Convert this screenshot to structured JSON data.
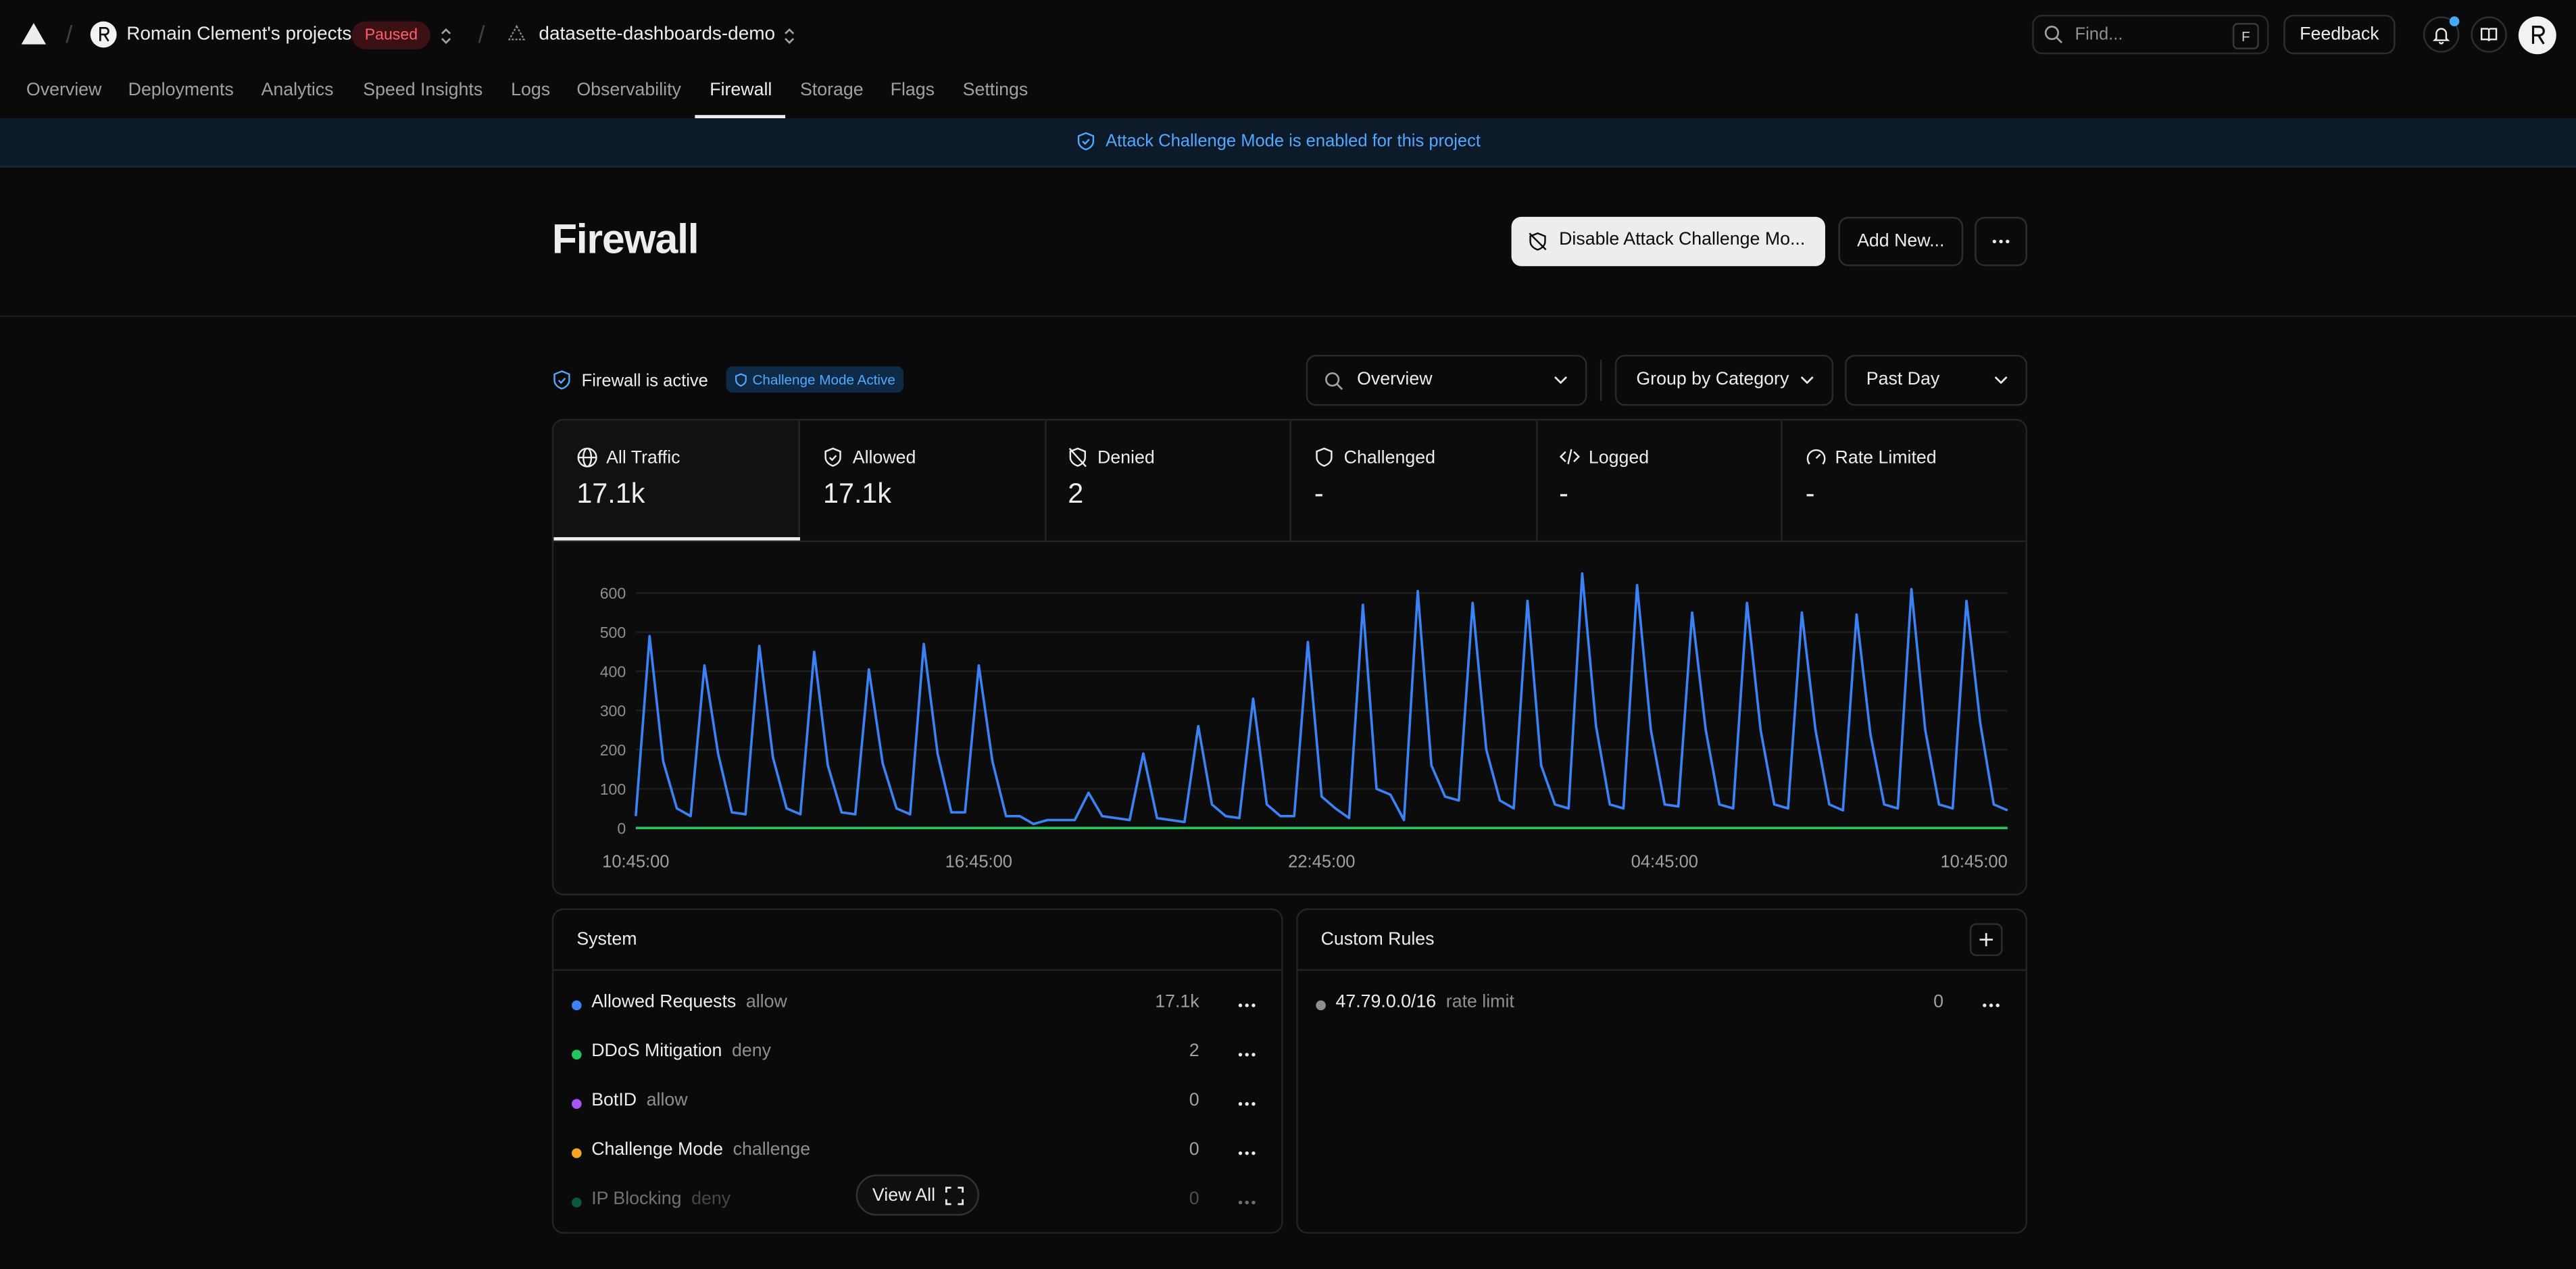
{
  "topbar": {
    "team_name": "Romain Clement's projects",
    "team_status": "Paused",
    "project_name": "datasette-dashboards-demo",
    "search_placeholder": "Find...",
    "search_shortcut": "F",
    "feedback_label": "Feedback"
  },
  "nav": {
    "items": [
      "Overview",
      "Deployments",
      "Analytics",
      "Speed Insights",
      "Logs",
      "Observability",
      "Firewall",
      "Storage",
      "Flags",
      "Settings"
    ],
    "active": "Firewall"
  },
  "banner": {
    "text": "Attack Challenge Mode is enabled for this project"
  },
  "header": {
    "title": "Firewall",
    "disable_label": "Disable Attack Challenge Mo...",
    "add_label": "Add New..."
  },
  "toolbar": {
    "status_text": "Firewall is active",
    "status_chip": "Challenge Mode Active",
    "view_select": "Overview",
    "group_select": "Group by Category",
    "time_select": "Past Day"
  },
  "stats": [
    {
      "label": "All Traffic",
      "value": "17.1k",
      "icon": "globe-icon"
    },
    {
      "label": "Allowed",
      "value": "17.1k",
      "icon": "shield-check-icon"
    },
    {
      "label": "Denied",
      "value": "2",
      "icon": "shield-off-icon"
    },
    {
      "label": "Challenged",
      "value": "-",
      "icon": "shield-icon"
    },
    {
      "label": "Logged",
      "value": "-",
      "icon": "code-icon"
    },
    {
      "label": "Rate Limited",
      "value": "-",
      "icon": "gauge-icon"
    }
  ],
  "chart_data": {
    "type": "line",
    "ylim": [
      0,
      600
    ],
    "y_ticks": [
      0,
      100,
      200,
      300,
      400,
      500,
      600
    ],
    "x_tick_labels": [
      "10:45:00",
      "16:45:00",
      "22:45:00",
      "04:45:00",
      "10:45:00"
    ],
    "grid": true,
    "series": [
      {
        "color": "#3b82f6",
        "values": [
          30,
          490,
          170,
          50,
          30,
          415,
          190,
          40,
          35,
          465,
          180,
          50,
          35,
          450,
          160,
          40,
          35,
          405,
          165,
          50,
          35,
          470,
          190,
          40,
          40,
          415,
          170,
          30,
          30,
          10,
          20,
          20,
          20,
          90,
          30,
          25,
          20,
          190,
          25,
          20,
          15,
          260,
          60,
          30,
          25,
          330,
          60,
          30,
          30,
          475,
          80,
          50,
          25,
          570,
          100,
          85,
          20,
          605,
          160,
          80,
          70,
          575,
          200,
          70,
          50,
          580,
          160,
          60,
          50,
          650,
          260,
          60,
          50,
          620,
          250,
          60,
          55,
          550,
          250,
          60,
          50,
          575,
          250,
          60,
          50,
          550,
          250,
          60,
          45,
          545,
          240,
          60,
          50,
          610,
          250,
          60,
          50,
          580,
          270,
          60,
          45
        ]
      },
      {
        "color": "#22c55e",
        "values": [
          0,
          0,
          0,
          0,
          0,
          0,
          0,
          0,
          0,
          0,
          0,
          0,
          0,
          0,
          0,
          0,
          0,
          0,
          0,
          0,
          0,
          0,
          0,
          0,
          0,
          0,
          0,
          0,
          0,
          0,
          0,
          0,
          0,
          0,
          0,
          0,
          0,
          0,
          0,
          0,
          0,
          0,
          0,
          0,
          0,
          0,
          0,
          0,
          0,
          0,
          0,
          0,
          0,
          0,
          0,
          0,
          0,
          0,
          0,
          0,
          0,
          0,
          0,
          0,
          0,
          0,
          0,
          0,
          0,
          0,
          0,
          0,
          0,
          0,
          0,
          0,
          0,
          0,
          0,
          0,
          0,
          0,
          0,
          0,
          0,
          0,
          0,
          0,
          0,
          0,
          0,
          0,
          0,
          0,
          0,
          0,
          0,
          0,
          0,
          0,
          0
        ]
      }
    ]
  },
  "system": {
    "title": "System",
    "rules": [
      {
        "name": "Allowed Requests",
        "action": "allow",
        "count": "17.1k",
        "color": "#3b82f6"
      },
      {
        "name": "DDoS Mitigation",
        "action": "deny",
        "count": "2",
        "color": "#22c55e"
      },
      {
        "name": "BotID",
        "action": "allow",
        "count": "0",
        "color": "#a855f7"
      },
      {
        "name": "Challenge Mode",
        "action": "challenge",
        "count": "0",
        "color": "#f5a524"
      },
      {
        "name": "IP Blocking",
        "action": "deny",
        "count": "0",
        "color": "#10b981"
      }
    ],
    "view_all_label": "View All"
  },
  "custom_rules": {
    "title": "Custom Rules",
    "rules": [
      {
        "name": "47.79.0.0/16",
        "action": "rate limit",
        "count": "0",
        "color": "#8f8f8f"
      }
    ]
  }
}
